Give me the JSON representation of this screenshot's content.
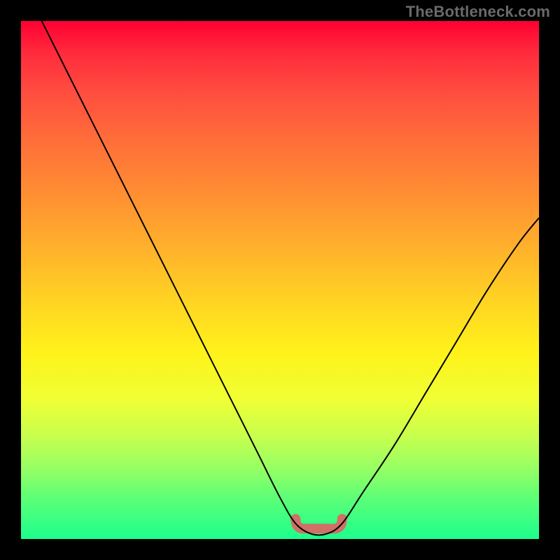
{
  "watermark": "TheBottleneck.com",
  "chart_data": {
    "type": "line",
    "title": "",
    "xlabel": "",
    "ylabel": "",
    "xlim": [
      0,
      100
    ],
    "ylim": [
      0,
      100
    ],
    "grid": false,
    "series": [
      {
        "name": "bottleneck-curve",
        "x": [
          4,
          10,
          16,
          22,
          28,
          34,
          40,
          46,
          50,
          53,
          56,
          59,
          62,
          66,
          72,
          78,
          84,
          90,
          96,
          100
        ],
        "values": [
          100,
          88,
          76,
          64,
          52,
          40,
          28,
          16,
          8,
          3,
          1,
          1,
          3,
          9,
          18,
          28,
          38,
          48,
          57,
          62
        ]
      }
    ],
    "annotations": [
      {
        "name": "bottleneck-region",
        "x_start": 53,
        "x_end": 62,
        "y": 2
      }
    ],
    "colors": {
      "background_top": "#ff0032",
      "background_bottom": "#1cff8c",
      "curve": "#000000",
      "bottleneck_mark": "#d07066",
      "frame": "#000000"
    }
  }
}
